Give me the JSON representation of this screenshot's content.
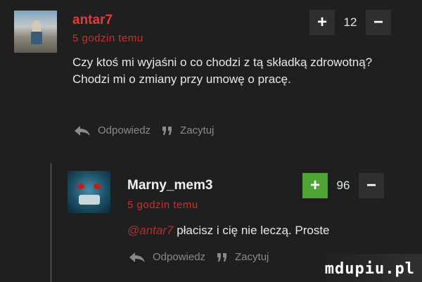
{
  "comments": [
    {
      "username": "antar7",
      "time": "5 godzin temu",
      "text": "Czy ktoś mi wyjaśni o co chodzi z tą składką zdrowotną? Chodzi mi o zmiany przy umowę o pracę.",
      "votes": "12",
      "plus_label": "+",
      "minus_label": "−",
      "reply_label": "Odpowiedz",
      "quote_label": "Zacytuj"
    },
    {
      "username": "Marny_mem3",
      "time": "5 godzin temu",
      "mention": "@antar7",
      "text": " płacisz i cię nie leczą. Proste",
      "votes": "96",
      "plus_label": "+",
      "minus_label": "−",
      "reply_label": "Odpowiedz",
      "quote_label": "Zacytuj"
    }
  ],
  "watermark": "mdupiu.pl",
  "colors": {
    "background": "#1f1f1f",
    "username_red": "#e23b3b",
    "plus_active": "#4fa434"
  }
}
